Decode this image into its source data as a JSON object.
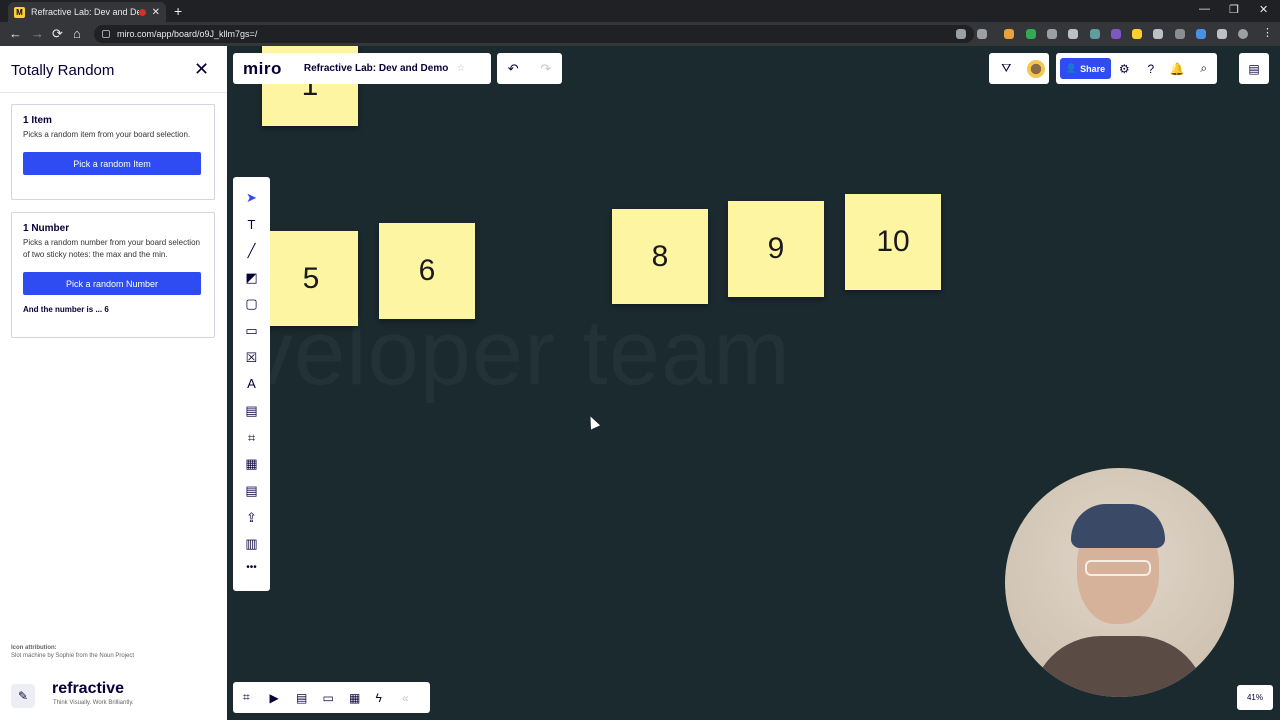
{
  "browser": {
    "tab_title": "Refractive Lab: Dev and Dem",
    "tab_close": "✕",
    "new_tab": "+",
    "url": "miro.com/app/board/o9J_kllm7gs=/",
    "window_controls": [
      "—",
      "❐",
      "✕"
    ],
    "nav": {
      "back": "←",
      "forward": "→",
      "reload": "⟳",
      "home": "⌂"
    }
  },
  "sidebar": {
    "title": "Totally Random",
    "close": "✕",
    "item_card": {
      "title": "1 Item",
      "description": "Picks a random item from your board selection.",
      "button": "Pick a random Item"
    },
    "number_card": {
      "title": "1 Number",
      "description": "Picks a random number from your board selection of two sticky notes: the max and the min.",
      "button": "Pick a random Number",
      "result": "And the number is ... 6"
    },
    "attribution_title": "Icon attribution:",
    "attribution_text": "Slot machine by Sophie from the Noun Project",
    "brand_name": "refractive",
    "brand_tagline": "Think Visually. Work Brilliantly."
  },
  "board": {
    "logo": "miro",
    "name": "Refractive Lab: Dev and Demo",
    "star": "☆",
    "undo": "↶",
    "redo": "↷",
    "share": "Share",
    "zoom": "41%",
    "background_text": "veloper team",
    "stickies": [
      "1",
      "5",
      "6",
      "8",
      "9",
      "10"
    ]
  },
  "icons": {
    "select": "➤",
    "text": "T",
    "line": "╱",
    "sticky": "◩",
    "shape": "▢",
    "card": "▭",
    "frame_x": "☒",
    "pen": "A",
    "comment": "▤",
    "frame": "⌗",
    "table": "▦",
    "template": "▤",
    "upload": "⇪",
    "kanban": "▥",
    "more": "•••",
    "filter": "⛛",
    "settings": "⚙",
    "help": "?",
    "bell": "🔔",
    "search": "⌕",
    "panel": "▤",
    "b_frame": "⌗",
    "b_present": "▶",
    "b_chat": "▤",
    "b_screens": "▭",
    "b_cards": "▦",
    "b_bolt": "ϟ",
    "b_collapse": "«"
  },
  "colors": {
    "board_bg": "#1b2a2f",
    "accent": "#2f4bf2",
    "sticky_yellow": "#fef5a3"
  }
}
